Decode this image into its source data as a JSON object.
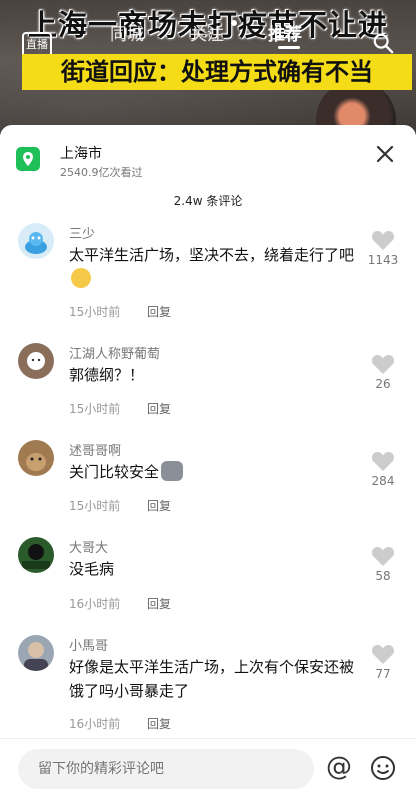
{
  "video": {
    "headline": "上海一商场未打疫苗不让进",
    "banner": "街道回应：处理方式确有不当",
    "tabs": [
      "同城",
      "关注",
      "推荐"
    ],
    "tv_label": "直播"
  },
  "location": {
    "name": "上海市",
    "views": "2540.9亿次看过"
  },
  "comment_count": "2.4w 条评论",
  "comments": [
    {
      "user": "三少",
      "text": "太平洋生活广场，坚决不去，绕着走行了吧",
      "time": "15小时前",
      "reply": "回复",
      "likes": "1143"
    },
    {
      "user": "江湖人称野葡萄",
      "text": "郭德纲？！",
      "time": "15小时前",
      "reply": "回复",
      "likes": "26"
    },
    {
      "user": "述哥哥啊",
      "text": "关门比较安全",
      "time": "15小时前",
      "reply": "回复",
      "likes": "284"
    },
    {
      "user": "大哥大",
      "text": "没毛病",
      "time": "16小时前",
      "reply": "回复",
      "likes": "58"
    },
    {
      "user": "小馬哥",
      "text": "好像是太平洋生活广场，上次有个保安还被饿了吗小哥暴走了",
      "time": "16小时前",
      "reply": "回复",
      "likes": "77"
    }
  ],
  "input": {
    "placeholder": "留下你的精彩评论吧"
  }
}
